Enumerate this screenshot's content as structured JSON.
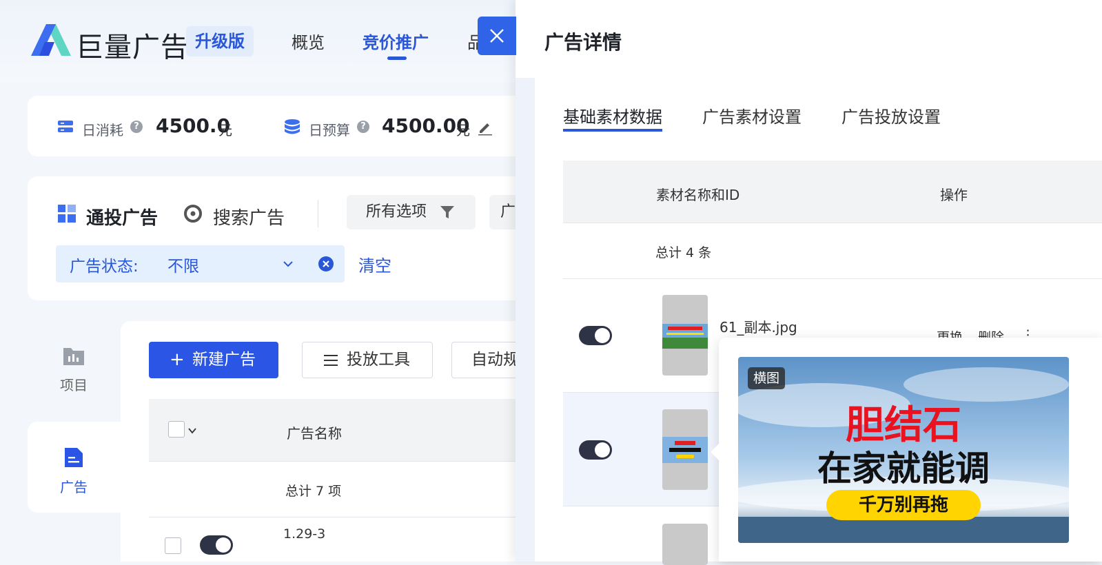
{
  "header": {
    "brand": "巨量广告",
    "edition_badge": "升级版",
    "nav": [
      "概览",
      "竞价推广",
      "品"
    ]
  },
  "stats": {
    "daily_cost_label": "日消耗",
    "daily_cost_value": "4500.0",
    "daily_cost_unit": "元",
    "daily_budget_label": "日预算",
    "daily_budget_value": "4500.00",
    "daily_budget_unit": "元"
  },
  "ad_types": {
    "general": "通投广告",
    "search": "搜索广告",
    "all_options": "所有选项",
    "more": "广"
  },
  "status_filter": {
    "label": "广告状态:",
    "value": "不限",
    "clear": "清空"
  },
  "sidebar": {
    "items": [
      {
        "label": "项目",
        "icon": "project-icon"
      },
      {
        "label": "广告",
        "icon": "ad-doc-icon",
        "active": true
      }
    ]
  },
  "toolbar": {
    "new_ad": "新建广告",
    "tools": "投放工具",
    "auto": "自动规"
  },
  "table": {
    "col_name": "广告名称",
    "total": "总计 7 项",
    "first_row_name": "1.29-3"
  },
  "drawer": {
    "title": "广告详情",
    "tabs": [
      "基础素材数据",
      "广告素材设置",
      "广告投放设置"
    ],
    "table": {
      "col_material": "素材名称和ID",
      "col_action": "操作",
      "total": "总计 4 条",
      "rows": [
        {
          "name": "61_副本.jpg",
          "actions": [
            "更换",
            "删除",
            "⋮"
          ]
        }
      ]
    },
    "preview": {
      "tag": "横图",
      "headline": "胆结石",
      "subline": "在家就能调",
      "button": "千万别再拖"
    }
  },
  "colors": {
    "accent": "#2b55e5",
    "toggle": "#2f3346"
  }
}
